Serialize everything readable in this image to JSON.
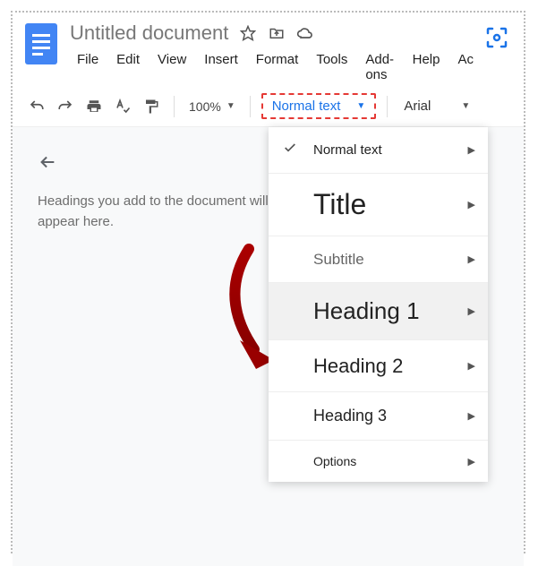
{
  "document": {
    "title": "Untitled document"
  },
  "menubar": {
    "items": [
      "File",
      "Edit",
      "View",
      "Insert",
      "Format",
      "Tools",
      "Add-ons",
      "Help",
      "Ac"
    ]
  },
  "toolbar": {
    "zoom": "100%",
    "style_dropdown_label": "Normal text",
    "font": "Arial"
  },
  "outline": {
    "message": "Headings you add to the document will appear here."
  },
  "style_dropdown": {
    "items": [
      {
        "key": "normal",
        "label": "Normal text",
        "checked": true,
        "class": "dd-label-normal"
      },
      {
        "key": "title",
        "label": "Title",
        "checked": false,
        "class": "dd-label-title"
      },
      {
        "key": "subtitle",
        "label": "Subtitle",
        "checked": false,
        "class": "dd-label-subtitle"
      },
      {
        "key": "h1",
        "label": "Heading 1",
        "checked": false,
        "class": "dd-label-h1"
      },
      {
        "key": "h2",
        "label": "Heading 2",
        "checked": false,
        "class": "dd-label-h2"
      },
      {
        "key": "h3",
        "label": "Heading 3",
        "checked": false,
        "class": "dd-label-h3"
      },
      {
        "key": "options",
        "label": "Options",
        "checked": false,
        "class": "dd-label-options"
      }
    ]
  }
}
